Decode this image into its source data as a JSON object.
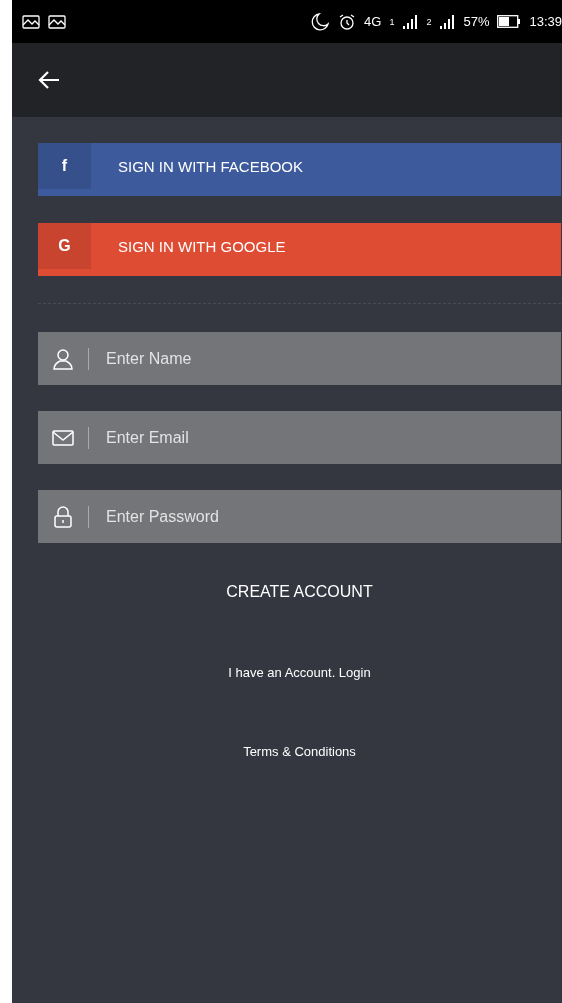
{
  "status_bar": {
    "network": "4G",
    "sim_1": "1",
    "sim_2": "2",
    "battery": "57%",
    "time": "13:39"
  },
  "social_buttons": [
    {
      "glyph": "f",
      "label": "SIGN IN WITH FACEBOOK",
      "color": "#3d5a9c"
    },
    {
      "glyph": "G",
      "label": "SIGN IN WITH GOOGLE",
      "color": "#df4c34"
    }
  ],
  "fields": [
    {
      "kind": "person",
      "placeholder": "Enter Name"
    },
    {
      "kind": "mail",
      "placeholder": "Enter Email"
    },
    {
      "kind": "lock",
      "placeholder": "Enter Password"
    }
  ],
  "create_button": "CREATE ACCOUNT",
  "login_link": "I have an Account. Login",
  "terms_link": "Terms & Conditions"
}
